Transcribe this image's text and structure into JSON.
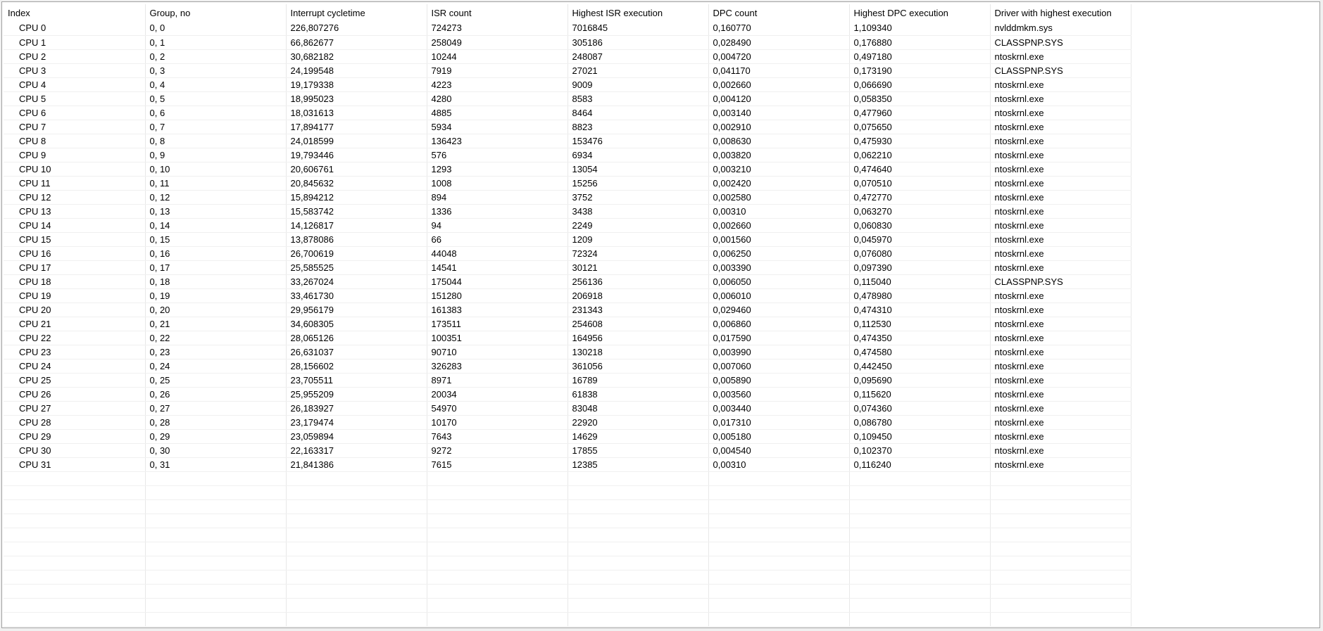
{
  "columns": [
    "Index",
    "Group, no",
    "Interrupt cycletime",
    "ISR count",
    "Highest ISR execution",
    "DPC count",
    "Highest DPC execution",
    "Driver with highest execution"
  ],
  "rows": [
    [
      "CPU 0",
      "0, 0",
      "226,807276",
      "724273",
      "7016845",
      "0,160770",
      "1,109340",
      "nvlddmkm.sys"
    ],
    [
      "CPU 1",
      "0, 1",
      "66,862677",
      "258049",
      "305186",
      "0,028490",
      "0,176880",
      "CLASSPNP.SYS"
    ],
    [
      "CPU 2",
      "0, 2",
      "30,682182",
      "10244",
      "248087",
      "0,004720",
      "0,497180",
      "ntoskrnl.exe"
    ],
    [
      "CPU 3",
      "0, 3",
      "24,199548",
      "7919",
      "27021",
      "0,041170",
      "0,173190",
      "CLASSPNP.SYS"
    ],
    [
      "CPU 4",
      "0, 4",
      "19,179338",
      "4223",
      "9009",
      "0,002660",
      "0,066690",
      "ntoskrnl.exe"
    ],
    [
      "CPU 5",
      "0, 5",
      "18,995023",
      "4280",
      "8583",
      "0,004120",
      "0,058350",
      "ntoskrnl.exe"
    ],
    [
      "CPU 6",
      "0, 6",
      "18,031613",
      "4885",
      "8464",
      "0,003140",
      "0,477960",
      "ntoskrnl.exe"
    ],
    [
      "CPU 7",
      "0, 7",
      "17,894177",
      "5934",
      "8823",
      "0,002910",
      "0,075650",
      "ntoskrnl.exe"
    ],
    [
      "CPU 8",
      "0, 8",
      "24,018599",
      "136423",
      "153476",
      "0,008630",
      "0,475930",
      "ntoskrnl.exe"
    ],
    [
      "CPU 9",
      "0, 9",
      "19,793446",
      "576",
      "6934",
      "0,003820",
      "0,062210",
      "ntoskrnl.exe"
    ],
    [
      "CPU 10",
      "0, 10",
      "20,606761",
      "1293",
      "13054",
      "0,003210",
      "0,474640",
      "ntoskrnl.exe"
    ],
    [
      "CPU 11",
      "0, 11",
      "20,845632",
      "1008",
      "15256",
      "0,002420",
      "0,070510",
      "ntoskrnl.exe"
    ],
    [
      "CPU 12",
      "0, 12",
      "15,894212",
      "894",
      "3752",
      "0,002580",
      "0,472770",
      "ntoskrnl.exe"
    ],
    [
      "CPU 13",
      "0, 13",
      "15,583742",
      "1336",
      "3438",
      "0,00310",
      "0,063270",
      "ntoskrnl.exe"
    ],
    [
      "CPU 14",
      "0, 14",
      "14,126817",
      "94",
      "2249",
      "0,002660",
      "0,060830",
      "ntoskrnl.exe"
    ],
    [
      "CPU 15",
      "0, 15",
      "13,878086",
      "66",
      "1209",
      "0,001560",
      "0,045970",
      "ntoskrnl.exe"
    ],
    [
      "CPU 16",
      "0, 16",
      "26,700619",
      "44048",
      "72324",
      "0,006250",
      "0,076080",
      "ntoskrnl.exe"
    ],
    [
      "CPU 17",
      "0, 17",
      "25,585525",
      "14541",
      "30121",
      "0,003390",
      "0,097390",
      "ntoskrnl.exe"
    ],
    [
      "CPU 18",
      "0, 18",
      "33,267024",
      "175044",
      "256136",
      "0,006050",
      "0,115040",
      "CLASSPNP.SYS"
    ],
    [
      "CPU 19",
      "0, 19",
      "33,461730",
      "151280",
      "206918",
      "0,006010",
      "0,478980",
      "ntoskrnl.exe"
    ],
    [
      "CPU 20",
      "0, 20",
      "29,956179",
      "161383",
      "231343",
      "0,029460",
      "0,474310",
      "ntoskrnl.exe"
    ],
    [
      "CPU 21",
      "0, 21",
      "34,608305",
      "173511",
      "254608",
      "0,006860",
      "0,112530",
      "ntoskrnl.exe"
    ],
    [
      "CPU 22",
      "0, 22",
      "28,065126",
      "100351",
      "164956",
      "0,017590",
      "0,474350",
      "ntoskrnl.exe"
    ],
    [
      "CPU 23",
      "0, 23",
      "26,631037",
      "90710",
      "130218",
      "0,003990",
      "0,474580",
      "ntoskrnl.exe"
    ],
    [
      "CPU 24",
      "0, 24",
      "28,156602",
      "326283",
      "361056",
      "0,007060",
      "0,442450",
      "ntoskrnl.exe"
    ],
    [
      "CPU 25",
      "0, 25",
      "23,705511",
      "8971",
      "16789",
      "0,005890",
      "0,095690",
      "ntoskrnl.exe"
    ],
    [
      "CPU 26",
      "0, 26",
      "25,955209",
      "20034",
      "61838",
      "0,003560",
      "0,115620",
      "ntoskrnl.exe"
    ],
    [
      "CPU 27",
      "0, 27",
      "26,183927",
      "54970",
      "83048",
      "0,003440",
      "0,074360",
      "ntoskrnl.exe"
    ],
    [
      "CPU 28",
      "0, 28",
      "23,179474",
      "10170",
      "22920",
      "0,017310",
      "0,086780",
      "ntoskrnl.exe"
    ],
    [
      "CPU 29",
      "0, 29",
      "23,059894",
      "7643",
      "14629",
      "0,005180",
      "0,109450",
      "ntoskrnl.exe"
    ],
    [
      "CPU 30",
      "0, 30",
      "22,163317",
      "9272",
      "17855",
      "0,004540",
      "0,102370",
      "ntoskrnl.exe"
    ],
    [
      "CPU 31",
      "0, 31",
      "21,841386",
      "7615",
      "12385",
      "0,00310",
      "0,116240",
      "ntoskrnl.exe"
    ]
  ]
}
